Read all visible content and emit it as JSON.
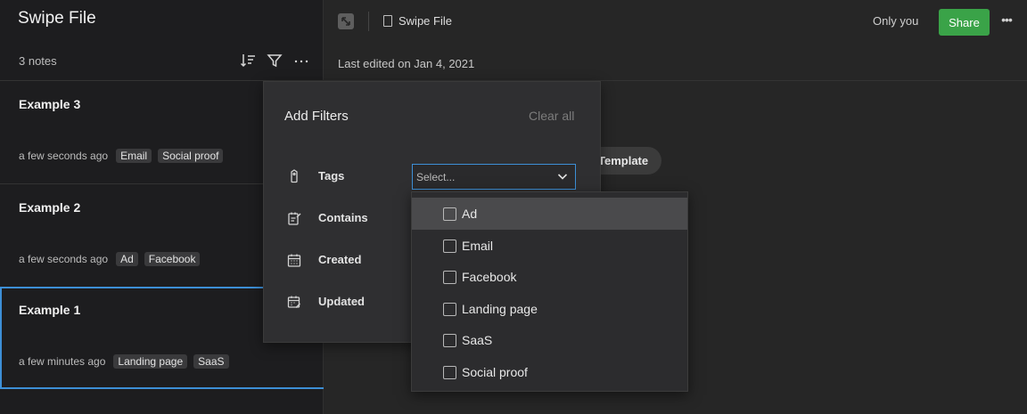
{
  "notebook": {
    "title": "Swipe File",
    "note_count": "3 notes"
  },
  "notes": [
    {
      "title": "Example 3",
      "time": "a few seconds ago",
      "tags": [
        "Email",
        "Social proof"
      ],
      "selected": false
    },
    {
      "title": "Example 2",
      "time": "a few seconds ago",
      "tags": [
        "Ad",
        "Facebook"
      ],
      "selected": false
    },
    {
      "title": "Example 1",
      "time": "a few minutes ago",
      "tags": [
        "Landing page",
        "SaaS"
      ],
      "selected": true
    }
  ],
  "topbar": {
    "notebook_name": "Swipe File",
    "sharing_status": "Only you",
    "share_label": "Share",
    "more_label": "•••"
  },
  "editor": {
    "last_edited": "Last edited on Jan 4, 2021",
    "template_label": "Template"
  },
  "filter_panel": {
    "title": "Add Filters",
    "clear_all": "Clear all",
    "rows": [
      {
        "label": "Tags",
        "icon": "tag-icon"
      },
      {
        "label": "Contains",
        "icon": "contains-icon"
      },
      {
        "label": "Created",
        "icon": "calendar-icon"
      },
      {
        "label": "Updated",
        "icon": "calendar-edit-icon"
      }
    ],
    "tags_select_placeholder": "Select..."
  },
  "tag_dropdown": {
    "options": [
      {
        "label": "Ad",
        "checked": false,
        "highlighted": true
      },
      {
        "label": "Email",
        "checked": false,
        "highlighted": false
      },
      {
        "label": "Facebook",
        "checked": false,
        "highlighted": false
      },
      {
        "label": "Landing page",
        "checked": false,
        "highlighted": false
      },
      {
        "label": "SaaS",
        "checked": false,
        "highlighted": false
      },
      {
        "label": "Social proof",
        "checked": false,
        "highlighted": false
      }
    ]
  },
  "colors": {
    "accent_blue": "#3d8fd6",
    "share_green": "#3aa348"
  }
}
